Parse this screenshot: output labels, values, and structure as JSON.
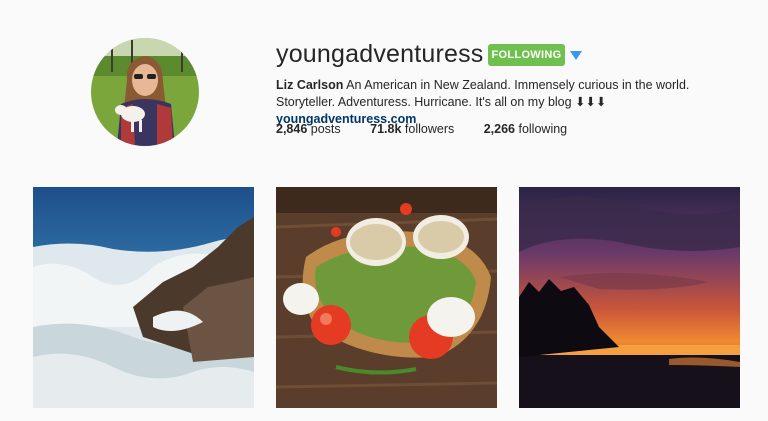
{
  "profile": {
    "username": "youngadventuress",
    "follow_label": "FOLLOWING",
    "dropdown_icon": "caret-down-icon",
    "bio_name": "Liz Carlson",
    "bio_text": "An American in New Zealand. Immensely curious in the world. Storyteller. Adventuress. Hurricane. It's all on my blog",
    "bio_arrows": "⬇⬇⬇",
    "bio_link": "youngadventuress.com"
  },
  "stats": [
    {
      "value": "2,846",
      "label": "posts"
    },
    {
      "value": "71.8k",
      "label": "followers"
    },
    {
      "value": "2,266",
      "label": "following"
    }
  ],
  "posts": [
    {
      "subject": "crashing-waves-on-rocks"
    },
    {
      "subject": "avocado-toast-with-poached-eggs"
    },
    {
      "subject": "sunset-silhouette-beach"
    }
  ],
  "colors": {
    "following_green": "#70c050",
    "dropdown_blue": "#3897f0",
    "link_blue": "#003569"
  }
}
